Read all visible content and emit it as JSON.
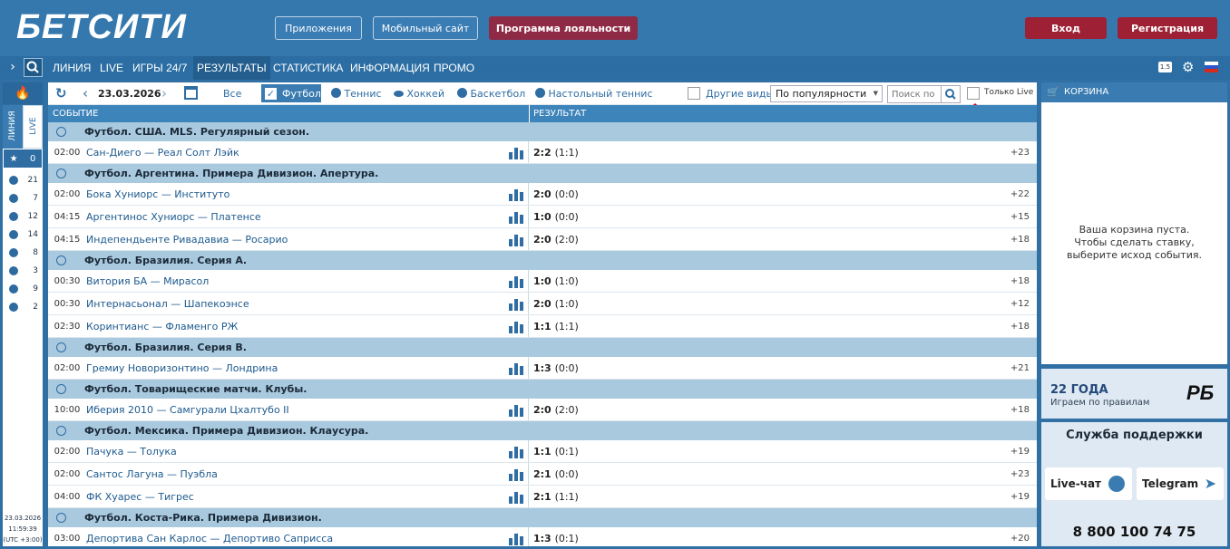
{
  "header": {
    "logo": "БЕТСИТИ",
    "apps": "Приложения",
    "mobile": "Мобильный сайт",
    "loyalty": "Программа лояльности",
    "login": "Вход",
    "register": "Регистрация"
  },
  "nav": {
    "items": [
      "ЛИНИЯ",
      "LIVE",
      "ИГРЫ 24/7",
      "РЕЗУЛЬТАТЫ",
      "СТАТИСТИКА",
      "ИНФОРМАЦИЯ",
      "ПРОМО"
    ],
    "scale": "1.5"
  },
  "sidebar": {
    "tab_line": "ЛИНИЯ",
    "tab_live": "LIVE",
    "favorites_count": "0",
    "sports": [
      {
        "icon": "football-icon",
        "count": "21"
      },
      {
        "icon": "tennis-icon",
        "count": "7"
      },
      {
        "icon": "hockey-icon",
        "count": "12"
      },
      {
        "icon": "basketball-icon",
        "count": "14"
      },
      {
        "icon": "table-tennis-icon",
        "count": "8"
      },
      {
        "icon": "volleyball-icon",
        "count": "3"
      },
      {
        "icon": "esports-icon",
        "count": "9"
      },
      {
        "icon": "baseball-icon",
        "count": "2"
      }
    ],
    "date": "23.03.2026",
    "time": "11:59:39",
    "tz": "(UTC +3:00)"
  },
  "toolbar": {
    "date": "23.03.2026",
    "all": "Все",
    "sports": [
      "Футбол",
      "Теннис",
      "Хоккей",
      "Баскетбол",
      "Настольный теннис"
    ],
    "other": "Другие виды",
    "sort": "По популярности",
    "search_placeholder": "Поиск по",
    "only_live": "Только Live"
  },
  "table": {
    "col_event": "СОБЫТИЕ",
    "col_result": "РЕЗУЛЬТАТ"
  },
  "groups": [
    {
      "title": "Футбол. США. MLS. Регулярный сезон.",
      "rows": [
        {
          "time": "02:00",
          "name": "Сан-Диего — Реал Солт Лэйк",
          "score": "2:2",
          "half": "(1:1)",
          "more": "+23"
        }
      ]
    },
    {
      "title": "Футбол. Аргентина. Примера Дивизион. Апертура.",
      "rows": [
        {
          "time": "02:00",
          "name": "Бока Хуниорс — Институто",
          "score": "2:0",
          "half": "(0:0)",
          "more": "+22"
        },
        {
          "time": "04:15",
          "name": "Аргентинос Хуниорс — Платенсе",
          "score": "1:0",
          "half": "(0:0)",
          "more": "+15"
        },
        {
          "time": "04:15",
          "name": "Индепендьенте Ривадавиа — Росарио",
          "score": "2:0",
          "half": "(2:0)",
          "more": "+18"
        }
      ]
    },
    {
      "title": "Футбол. Бразилия. Серия А.",
      "rows": [
        {
          "time": "00:30",
          "name": "Витория БА — Мирасол",
          "score": "1:0",
          "half": "(1:0)",
          "more": "+18"
        },
        {
          "time": "00:30",
          "name": "Интернасьонал — Шапекоэнсе",
          "score": "2:0",
          "half": "(1:0)",
          "more": "+12"
        },
        {
          "time": "02:30",
          "name": "Коринтианс — Фламенго РЖ",
          "score": "1:1",
          "half": "(1:1)",
          "more": "+18"
        }
      ]
    },
    {
      "title": "Футбол. Бразилия. Серия B.",
      "rows": [
        {
          "time": "02:00",
          "name": "Гремиу Новоризонтино — Лондрина",
          "score": "1:3",
          "half": "(0:0)",
          "more": "+21"
        }
      ]
    },
    {
      "title": "Футбол. Товарищеские матчи. Клубы.",
      "rows": [
        {
          "time": "10:00",
          "name": "Иберия 2010 — Самгурали Цхалтубо II",
          "score": "2:0",
          "half": "(2:0)",
          "more": "+18"
        }
      ]
    },
    {
      "title": "Футбол. Мексика. Примера Дивизион. Клаусура.",
      "rows": [
        {
          "time": "02:00",
          "name": "Пачука — Толука",
          "score": "1:1",
          "half": "(0:1)",
          "more": "+19"
        },
        {
          "time": "02:00",
          "name": "Сантос Лагуна — Пуэбла",
          "score": "2:1",
          "half": "(0:0)",
          "more": "+23"
        },
        {
          "time": "04:00",
          "name": "ФК Хуарес — Тигрес",
          "score": "2:1",
          "half": "(1:1)",
          "more": "+19"
        }
      ]
    },
    {
      "title": "Футбол. Коста-Рика. Примера Дивизион.",
      "rows": [
        {
          "time": "03:00",
          "name": "Депортива Сан Карлос — Депортиво Саприсса",
          "score": "1:3",
          "half": "(0:1)",
          "more": "+20"
        }
      ]
    }
  ],
  "cart": {
    "title": "КОРЗИНА",
    "empty1": "Ваша корзина пуста.",
    "empty2": "Чтобы сделать ставку, выберите исход события."
  },
  "banner": {
    "years": "22 ГОДА",
    "slogan": "Играем по правилам",
    "logo": "РБ"
  },
  "support": {
    "title": "Служба поддержки",
    "chat": "Live-чат",
    "telegram": "Telegram",
    "phone": "8 800 100 74 75"
  }
}
